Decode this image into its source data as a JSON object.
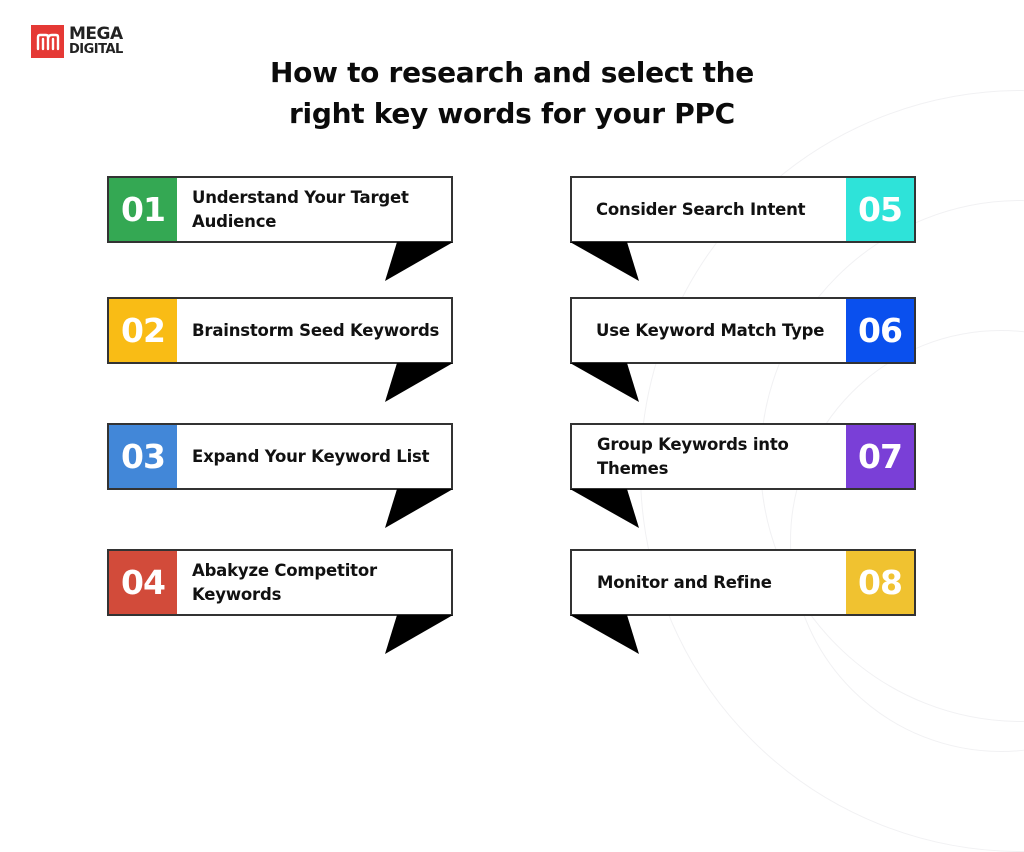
{
  "brand": {
    "logo_mark": "m",
    "name_line1": "MEGA",
    "name_line2": "DIGITAL",
    "color": "#E53935"
  },
  "title": {
    "line1": "How to research and select the",
    "line2": "right key words for your PPC"
  },
  "steps": [
    {
      "number": "01",
      "label": "Understand Your Target Audience",
      "color": "#34A853",
      "column": "left"
    },
    {
      "number": "02",
      "label": "Brainstorm Seed Keywords",
      "color": "#F9BC15",
      "column": "left"
    },
    {
      "number": "03",
      "label": "Expand Your Keyword List",
      "color": "#4287D8",
      "column": "left"
    },
    {
      "number": "04",
      "label": "Abakyze Competitor Keywords",
      "color": "#D24B3A",
      "column": "left"
    },
    {
      "number": "05",
      "label": "Consider Search Intent",
      "color": "#2EE3D9",
      "column": "right"
    },
    {
      "number": "06",
      "label": "Use Keyword Match Type",
      "color": "#0A50EE",
      "column": "right"
    },
    {
      "number": "07",
      "label": "Group Keywords into Themes",
      "color": "#7A3FD7",
      "column": "right"
    },
    {
      "number": "08",
      "label": "Monitor and Refine",
      "color": "#F0C230",
      "column": "right"
    }
  ]
}
